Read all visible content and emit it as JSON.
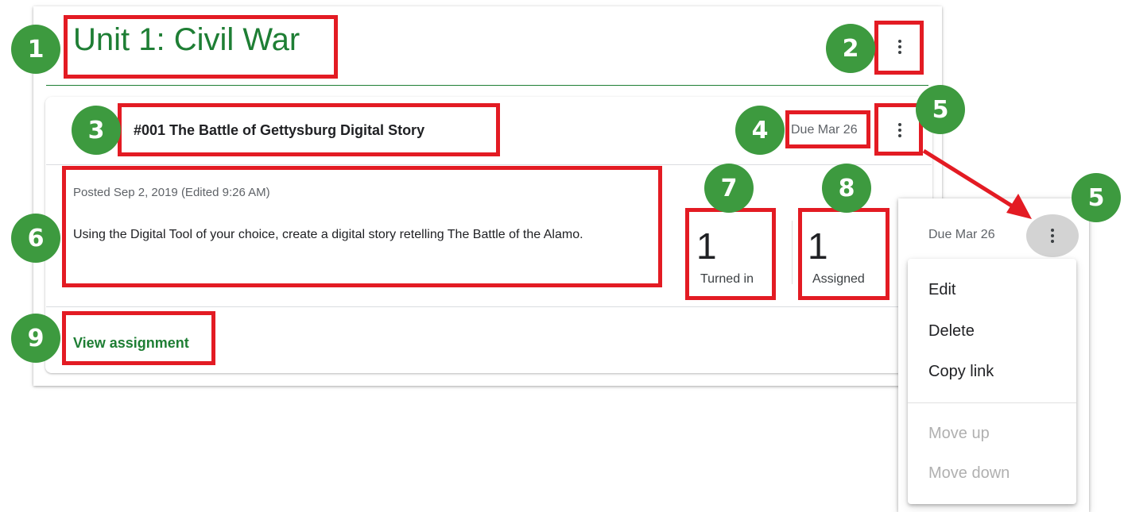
{
  "topic": {
    "title": "Unit 1: Civil War"
  },
  "assignment": {
    "title": "#001 The Battle of Gettysburg Digital Story",
    "due": "Due Mar 26",
    "posted": "Posted Sep 2, 2019 (Edited 9:26 AM)",
    "description": "Using the Digital Tool of your choice, create a digital story retelling The Battle of the Alamo.",
    "turned_in_count": "1",
    "turned_in_label": "Turned in",
    "assigned_count": "1",
    "assigned_label": "Assigned",
    "view_link": "View assignment"
  },
  "popup": {
    "due": "Due Mar 26",
    "menu": {
      "edit": "Edit",
      "delete": "Delete",
      "copy_link": "Copy link",
      "move_up": "Move up",
      "move_down": "Move down"
    }
  },
  "badges": {
    "b1": "1",
    "b2": "2",
    "b3": "3",
    "b4": "4",
    "b5": "5",
    "b6": "6",
    "b7": "7",
    "b8": "8",
    "b9": "9",
    "b5_popup": "5"
  },
  "icons": {
    "topic_menu": "more-vert-icon",
    "assignment_menu": "more-vert-icon",
    "arrow": "arrow-icon"
  },
  "colors": {
    "accent_green": "#1e7e34",
    "badge_green": "#3d9a3f",
    "highlight_red": "#e31b23"
  }
}
